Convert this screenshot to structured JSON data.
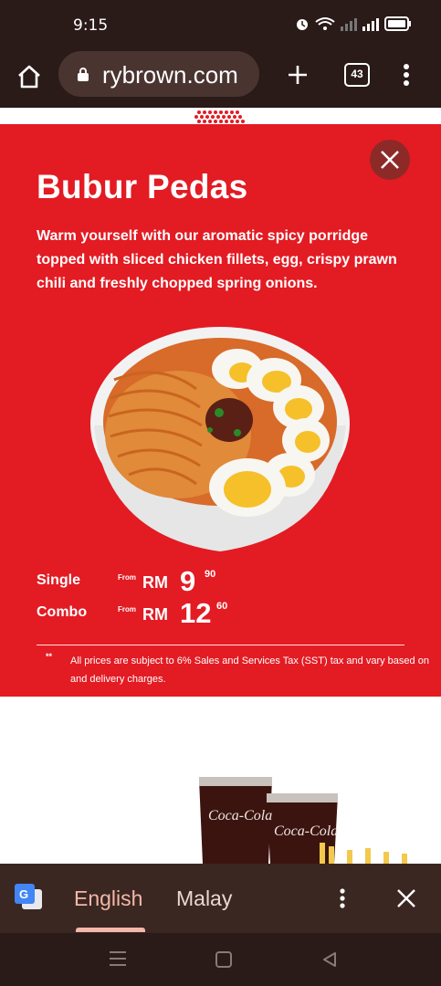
{
  "status_bar": {
    "time": "9:15"
  },
  "browser": {
    "url": "rybrown.com",
    "tab_count": "43"
  },
  "promo": {
    "title": "Bubur Pedas",
    "description": "Warm yourself with our aromatic spicy porridge topped with sliced chicken fillets, egg, crispy prawn chili and freshly chopped spring onions.",
    "prices": [
      {
        "label": "Single",
        "from": "From",
        "currency": "RM",
        "main": "9",
        "cents": "90"
      },
      {
        "label": "Combo",
        "from": "From",
        "currency": "RM",
        "main": "12",
        "cents": "60"
      }
    ],
    "note_marker": "**",
    "note": "All prices are subject to 6% Sales and Services Tax (SST) tax and vary based on and delivery charges."
  },
  "drinks": {
    "brand_text": "Coca-Cola"
  },
  "translate_bar": {
    "languages": [
      "English",
      "Malay"
    ],
    "selected": "English"
  },
  "colors": {
    "brand_red": "#e31b23",
    "chrome_dark": "#2a1a18",
    "translate_bar": "#3a2722",
    "accent_peach": "#f4b7a8"
  },
  "icons": [
    "home-icon",
    "lock-icon",
    "plus-icon",
    "tabs-icon",
    "more-vert-icon",
    "close-icon",
    "google-translate-icon",
    "nav-menu-icon",
    "nav-home-icon",
    "nav-back-icon"
  ]
}
